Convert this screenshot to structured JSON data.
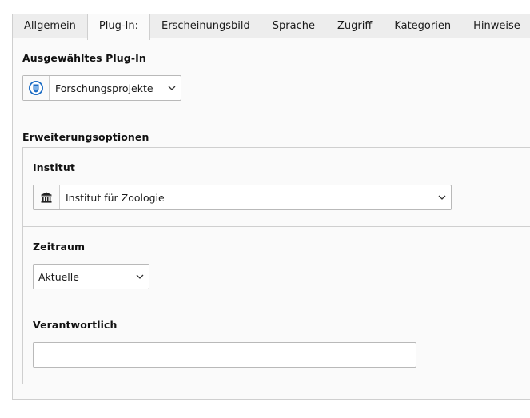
{
  "tabs": [
    {
      "label": "Allgemein",
      "active": false
    },
    {
      "label": "Plug-In:",
      "active": true
    },
    {
      "label": "Erscheinungsbild",
      "active": false
    },
    {
      "label": "Sprache",
      "active": false
    },
    {
      "label": "Zugriff",
      "active": false
    },
    {
      "label": "Kategorien",
      "active": false
    },
    {
      "label": "Hinweise",
      "active": false
    }
  ],
  "plugin": {
    "label": "Ausgewähltes Plug-In",
    "selected": "Forschungsprojekte",
    "icon": "plugin-shield-icon"
  },
  "extension": {
    "title": "Erweiterungsoptionen",
    "institut": {
      "label": "Institut",
      "selected": "Institut für Zoologie",
      "icon": "institution-building-icon"
    },
    "zeitraum": {
      "label": "Zeitraum",
      "selected": "Aktuelle"
    },
    "verantwortlich": {
      "label": "Verantwortlich",
      "value": "",
      "placeholder": ""
    }
  },
  "colors": {
    "plugin_icon_blue": "#1c6cc4",
    "border": "#cfcfcf",
    "tab_bar": "#ededed",
    "panel": "#fafafa"
  }
}
